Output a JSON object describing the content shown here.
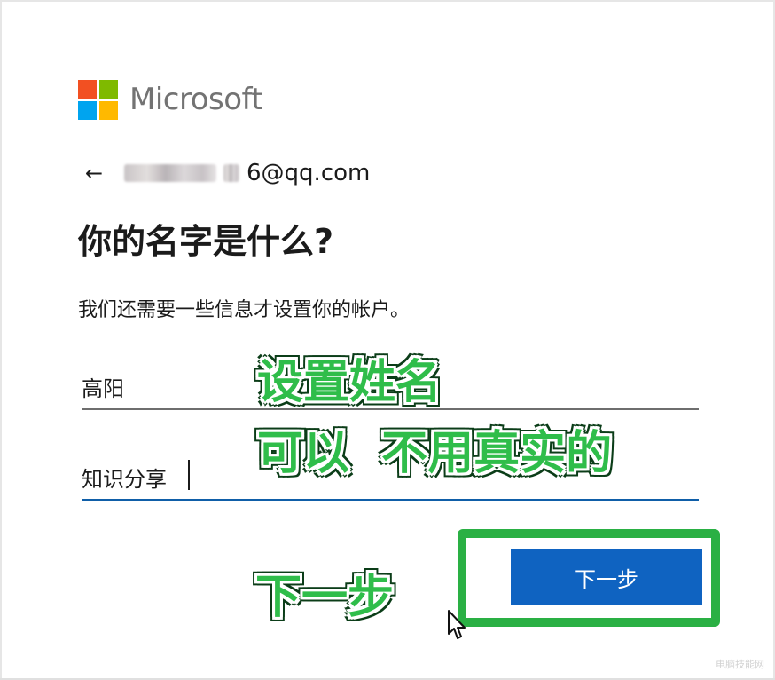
{
  "brand": {
    "name": "Microsoft",
    "logo_colors": [
      "#f25022",
      "#7fba00",
      "#00a4ef",
      "#ffb900"
    ]
  },
  "identity": {
    "email_visible": "6@qq.com",
    "back_icon": "arrow-left-icon"
  },
  "heading": "你的名字是什么?",
  "subtitle": "我们还需要一些信息才设置你的帐户。",
  "form": {
    "surname_value": "高阳",
    "given_name_value": "知识分享"
  },
  "next_button": {
    "label": "下一步",
    "color": "#0f63c1"
  },
  "annotations": {
    "line1": "设置姓名",
    "line2": "可以 不用真实的",
    "line3": "下一步",
    "highlight_color": "#2ab044"
  },
  "watermark": "电脑技能网"
}
